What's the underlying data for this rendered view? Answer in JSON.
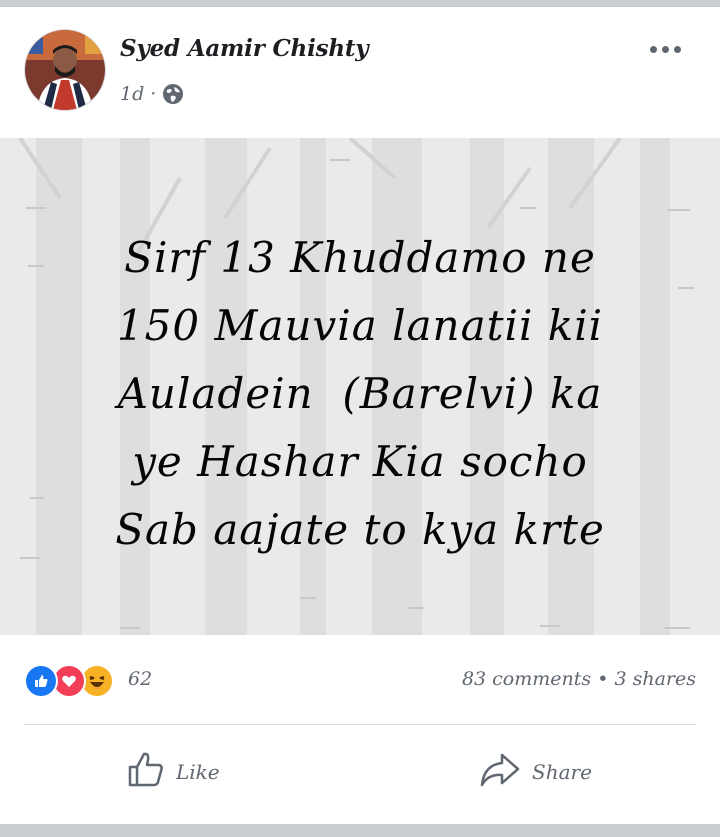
{
  "post": {
    "author": "Syed Aamir Chishty",
    "time": "1d",
    "separator": "·",
    "privacy_icon": "globe-icon",
    "menu_icon": "more-options-icon",
    "text_lines": [
      "Sirf 13 Khuddamo ne",
      "150 Mauvia lanatii kii",
      "Auladein  (Barelvi) ka",
      "ye Hashar Kia socho",
      "Sab aajate to kya krte"
    ],
    "background_color": "#eaeaea"
  },
  "stats": {
    "reaction_icons": [
      "like-reaction-icon",
      "love-reaction-icon",
      "haha-reaction-icon"
    ],
    "reaction_count": "62",
    "comments": "83 comments",
    "bullet": "•",
    "shares": "3 shares"
  },
  "actions": {
    "like_label": "Like",
    "share_label": "Share"
  },
  "colors": {
    "like_blue": "#1877f2",
    "love_red": "#f33e58",
    "haha_yellow": "#f7b125",
    "secondary_text": "#606770"
  }
}
